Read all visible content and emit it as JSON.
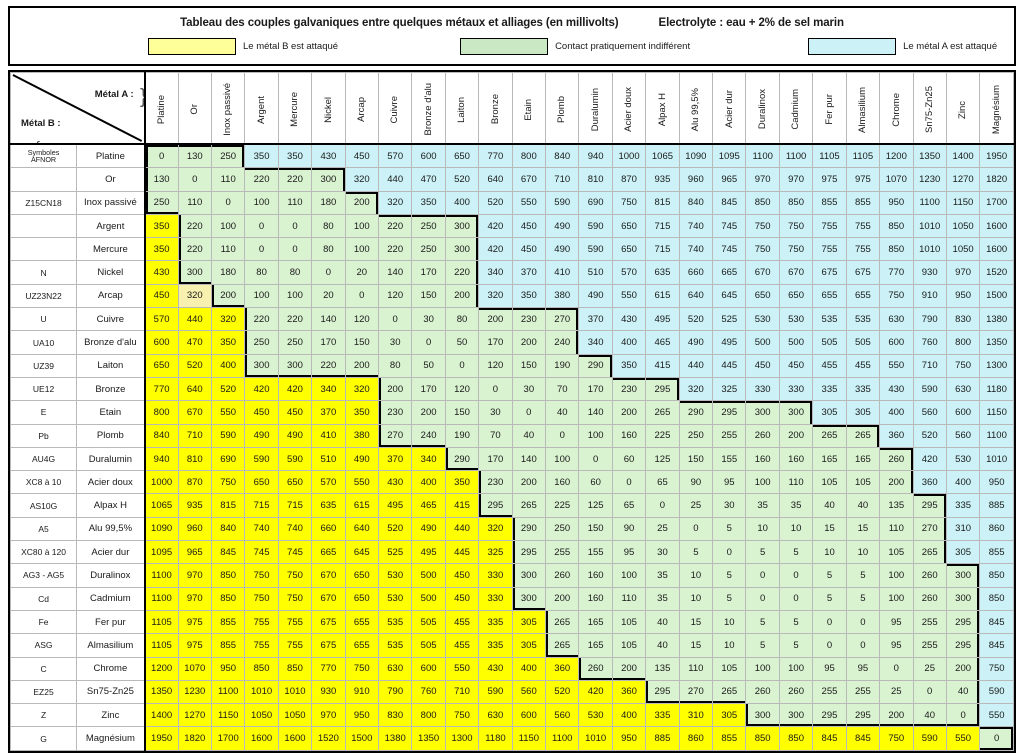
{
  "header": {
    "title": "Tableau des couples galvaniques entre quelques métaux et alliages (en millivolts)",
    "electrolyte": "Electrolyte : eau + 2% de sel marin",
    "legend": [
      {
        "label": "Le métal B est attaqué",
        "color": "#ffff99",
        "name": "yellow"
      },
      {
        "label": "Contact pratiquement indifférent",
        "color": "#c9e8c3",
        "name": "green"
      },
      {
        "label": "Le métal A est attaqué",
        "color": "#ccf2f7",
        "name": "blue"
      }
    ]
  },
  "corner": {
    "metal_a_label": "Métal A :",
    "metal_b_label": "Métal B :",
    "afnor_header": "Symboles AFNOR"
  },
  "columns": [
    "Platine",
    "Or",
    "Inox passivé",
    "Argent",
    "Mercure",
    "Nickel",
    "Arcap",
    "Cuivre",
    "Bronze d'alu",
    "Laiton",
    "Bronze",
    "Etain",
    "Plomb",
    "Duralumin",
    "Acier doux",
    "Alpax H",
    "Alu 99,5%",
    "Acier dur",
    "Duralinox",
    "Cadmium",
    "Fer pur",
    "Almasilium",
    "Chrome",
    "Sn75-Zn25",
    "Zinc",
    "Magnésium"
  ],
  "rows": [
    {
      "afnor": "Symboles AFNOR",
      "metal": "Platine",
      "values": [
        0,
        130,
        250,
        350,
        350,
        430,
        450,
        570,
        600,
        650,
        770,
        800,
        840,
        940,
        1000,
        1065,
        1090,
        1095,
        1100,
        1100,
        1105,
        1105,
        1200,
        1350,
        1400,
        1950
      ]
    },
    {
      "afnor": "",
      "metal": "Or",
      "values": [
        130,
        0,
        110,
        220,
        220,
        300,
        320,
        440,
        470,
        520,
        640,
        670,
        710,
        810,
        870,
        935,
        960,
        965,
        970,
        970,
        975,
        975,
        1070,
        1230,
        1270,
        1820
      ]
    },
    {
      "afnor": "Z15CN18",
      "metal": "Inox passivé",
      "values": [
        250,
        110,
        0,
        100,
        110,
        180,
        200,
        320,
        350,
        400,
        520,
        550,
        590,
        690,
        750,
        815,
        840,
        845,
        850,
        850,
        855,
        855,
        950,
        1100,
        1150,
        1700
      ]
    },
    {
      "afnor": "",
      "metal": "Argent",
      "values": [
        350,
        220,
        100,
        0,
        0,
        80,
        100,
        220,
        250,
        300,
        420,
        450,
        490,
        590,
        650,
        715,
        740,
        745,
        750,
        750,
        755,
        755,
        850,
        1010,
        1050,
        1600
      ]
    },
    {
      "afnor": "",
      "metal": "Mercure",
      "values": [
        350,
        220,
        110,
        0,
        0,
        80,
        100,
        220,
        250,
        300,
        420,
        450,
        490,
        590,
        650,
        715,
        740,
        745,
        750,
        750,
        755,
        755,
        850,
        1010,
        1050,
        1600
      ]
    },
    {
      "afnor": "N",
      "metal": "Nickel",
      "values": [
        430,
        300,
        180,
        80,
        80,
        0,
        20,
        140,
        170,
        220,
        340,
        370,
        410,
        510,
        570,
        635,
        660,
        665,
        670,
        670,
        675,
        675,
        770,
        930,
        970,
        1520
      ]
    },
    {
      "afnor": "UZ23N22",
      "metal": "Arcap",
      "values": [
        450,
        320,
        200,
        100,
        100,
        20,
        0,
        120,
        150,
        200,
        320,
        350,
        380,
        490,
        550,
        615,
        640,
        645,
        650,
        650,
        655,
        655,
        750,
        910,
        950,
        1500
      ]
    },
    {
      "afnor": "U",
      "metal": "Cuivre",
      "values": [
        570,
        440,
        320,
        220,
        220,
        140,
        120,
        0,
        30,
        80,
        200,
        230,
        270,
        370,
        430,
        495,
        520,
        525,
        530,
        530,
        535,
        535,
        630,
        790,
        830,
        1380
      ]
    },
    {
      "afnor": "UA10",
      "metal": "Bronze d'alu",
      "values": [
        600,
        470,
        350,
        250,
        250,
        170,
        150,
        30,
        0,
        50,
        170,
        200,
        240,
        340,
        400,
        465,
        490,
        495,
        500,
        500,
        505,
        505,
        600,
        760,
        800,
        1350
      ]
    },
    {
      "afnor": "UZ39",
      "metal": "Laiton",
      "values": [
        650,
        520,
        400,
        300,
        300,
        220,
        200,
        80,
        50,
        0,
        120,
        150,
        190,
        290,
        350,
        415,
        440,
        445,
        450,
        450,
        455,
        455,
        550,
        710,
        750,
        1300
      ]
    },
    {
      "afnor": "UE12",
      "metal": "Bronze",
      "values": [
        770,
        640,
        520,
        420,
        420,
        340,
        320,
        200,
        170,
        120,
        0,
        30,
        70,
        170,
        230,
        295,
        320,
        325,
        330,
        330,
        335,
        335,
        430,
        590,
        630,
        1180
      ]
    },
    {
      "afnor": "E",
      "metal": "Etain",
      "values": [
        800,
        670,
        550,
        450,
        450,
        370,
        350,
        230,
        200,
        150,
        30,
        0,
        40,
        140,
        200,
        265,
        290,
        295,
        300,
        300,
        305,
        305,
        400,
        560,
        600,
        1150
      ]
    },
    {
      "afnor": "Pb",
      "metal": "Plomb",
      "values": [
        840,
        710,
        590,
        490,
        490,
        410,
        380,
        270,
        240,
        190,
        70,
        40,
        0,
        100,
        160,
        225,
        250,
        255,
        260,
        200,
        265,
        265,
        360,
        520,
        560,
        1100
      ]
    },
    {
      "afnor": "AU4G",
      "metal": "Duralumin",
      "values": [
        940,
        810,
        690,
        590,
        590,
        510,
        490,
        370,
        340,
        290,
        170,
        140,
        100,
        0,
        60,
        125,
        150,
        155,
        160,
        160,
        165,
        165,
        260,
        420,
        530,
        1010
      ]
    },
    {
      "afnor": "XC8 à 10",
      "metal": "Acier doux",
      "values": [
        1000,
        870,
        750,
        650,
        650,
        570,
        550,
        430,
        400,
        350,
        230,
        200,
        160,
        60,
        0,
        65,
        90,
        95,
        100,
        110,
        105,
        105,
        200,
        360,
        400,
        950
      ]
    },
    {
      "afnor": "AS10G",
      "metal": "Alpax H",
      "values": [
        1065,
        935,
        815,
        715,
        715,
        635,
        615,
        495,
        465,
        415,
        295,
        265,
        225,
        125,
        65,
        0,
        25,
        30,
        35,
        35,
        40,
        40,
        135,
        295,
        335,
        885
      ]
    },
    {
      "afnor": "A5",
      "metal": "Alu 99,5%",
      "values": [
        1090,
        960,
        840,
        740,
        740,
        660,
        640,
        520,
        490,
        440,
        320,
        290,
        250,
        150,
        90,
        25,
        0,
        5,
        10,
        10,
        15,
        15,
        110,
        270,
        310,
        860
      ]
    },
    {
      "afnor": "XC80 à 120",
      "metal": "Acier dur",
      "values": [
        1095,
        965,
        845,
        745,
        745,
        665,
        645,
        525,
        495,
        445,
        325,
        295,
        255,
        155,
        95,
        30,
        5,
        0,
        5,
        5,
        10,
        10,
        105,
        265,
        305,
        855
      ]
    },
    {
      "afnor": "AG3 - AG5",
      "metal": "Duralinox",
      "values": [
        1100,
        970,
        850,
        750,
        750,
        670,
        650,
        530,
        500,
        450,
        330,
        300,
        260,
        160,
        100,
        35,
        10,
        5,
        0,
        0,
        5,
        5,
        100,
        260,
        300,
        850
      ]
    },
    {
      "afnor": "Cd",
      "metal": "Cadmium",
      "values": [
        1100,
        970,
        850,
        750,
        750,
        670,
        650,
        530,
        500,
        450,
        330,
        300,
        200,
        160,
        110,
        35,
        10,
        5,
        0,
        0,
        5,
        5,
        100,
        260,
        300,
        850
      ]
    },
    {
      "afnor": "Fe",
      "metal": "Fer pur",
      "values": [
        1105,
        975,
        855,
        755,
        755,
        675,
        655,
        535,
        505,
        455,
        335,
        305,
        265,
        165,
        105,
        40,
        15,
        10,
        5,
        5,
        0,
        0,
        95,
        255,
        295,
        845
      ]
    },
    {
      "afnor": "ASG",
      "metal": "Almasilium",
      "values": [
        1105,
        975,
        855,
        755,
        755,
        675,
        655,
        535,
        505,
        455,
        335,
        305,
        265,
        165,
        105,
        40,
        15,
        10,
        5,
        5,
        0,
        0,
        95,
        255,
        295,
        845
      ]
    },
    {
      "afnor": "C",
      "metal": "Chrome",
      "values": [
        1200,
        1070,
        950,
        850,
        850,
        770,
        750,
        630,
        600,
        550,
        430,
        400,
        360,
        260,
        200,
        135,
        110,
        105,
        100,
        100,
        95,
        95,
        0,
        25,
        200,
        750
      ]
    },
    {
      "afnor": "EZ25",
      "metal": "Sn75-Zn25",
      "values": [
        1350,
        1230,
        1100,
        1010,
        1010,
        930,
        910,
        790,
        760,
        710,
        590,
        560,
        520,
        420,
        360,
        295,
        270,
        265,
        260,
        260,
        255,
        255,
        25,
        0,
        40,
        590
      ]
    },
    {
      "afnor": "Z",
      "metal": "Zinc",
      "values": [
        1400,
        1270,
        1150,
        1050,
        1050,
        970,
        950,
        830,
        800,
        750,
        630,
        600,
        560,
        530,
        400,
        335,
        310,
        305,
        300,
        300,
        295,
        295,
        200,
        40,
        0,
        550
      ]
    },
    {
      "afnor": "G",
      "metal": "Magnésium",
      "values": [
        1950,
        1820,
        1700,
        1600,
        1600,
        1520,
        1500,
        1380,
        1350,
        1300,
        1180,
        1150,
        1100,
        1010,
        950,
        885,
        860,
        855,
        850,
        850,
        845,
        845,
        750,
        590,
        550,
        0
      ]
    }
  ],
  "cell_colors": {
    "yellow": "#ffff00",
    "cream": "#f7f0ae",
    "green": "#d9f2d0",
    "blue": "#ccf2f7"
  },
  "special_cells": [
    {
      "row": 6,
      "col": 1,
      "style": "cream"
    }
  ]
}
